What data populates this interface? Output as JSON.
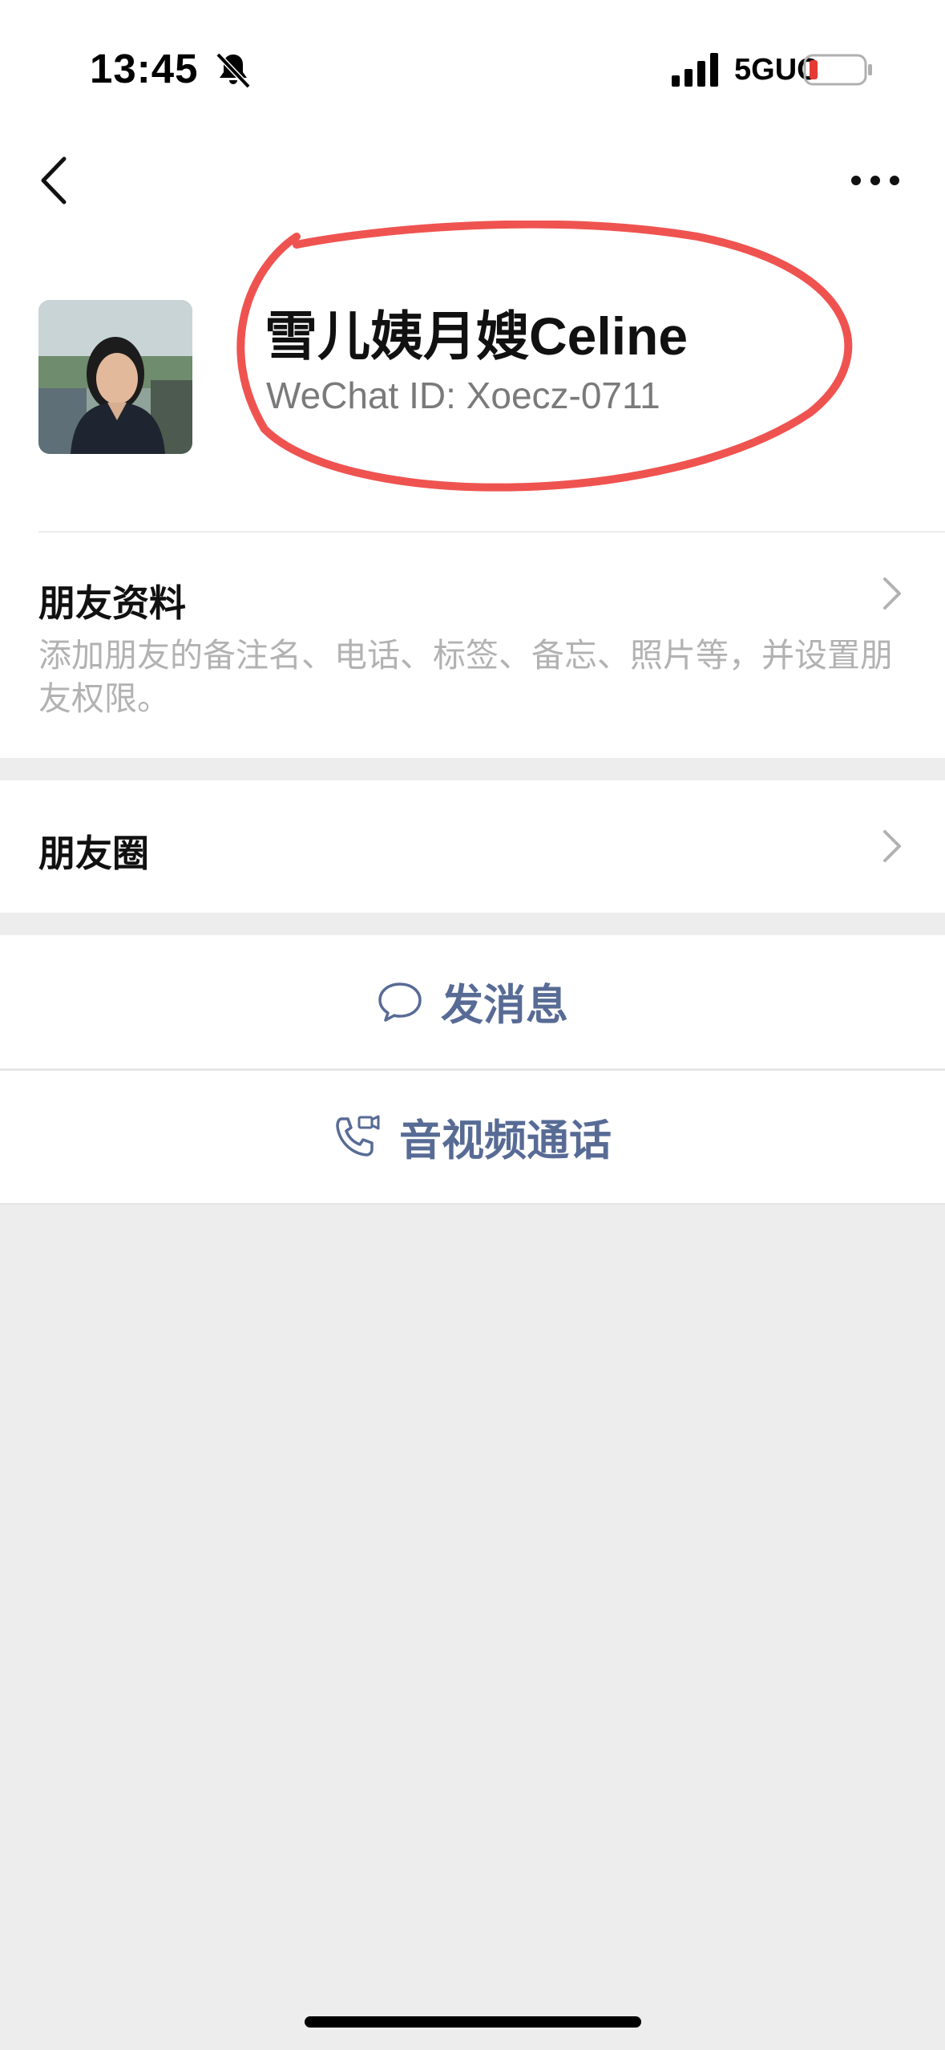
{
  "status_bar": {
    "time": "13:45",
    "network": "5GUC",
    "icons": [
      "bell-slash-icon",
      "signal-icon",
      "battery-low-icon"
    ],
    "battery_color": "#e53935"
  },
  "nav": {
    "back_icon": "chevron-left-icon",
    "more_icon": "ellipsis-icon"
  },
  "profile": {
    "display_name": "雪儿姨月嫂Celine",
    "wechat_id": "WeChat ID: Xoecz-0711",
    "annotation_color": "#ef5350"
  },
  "rows": {
    "friend_info": {
      "title": "朋友资料",
      "description": "添加朋友的备注名、电话、标签、备忘、照片等，并设置朋友权限。"
    },
    "moments": {
      "title": "朋友圈"
    }
  },
  "actions": {
    "message": {
      "label": "发消息",
      "icon": "chat-bubble-icon"
    },
    "call": {
      "label": "音视频通话",
      "icon": "phone-video-icon"
    }
  },
  "colors": {
    "link": "#576b95",
    "background": "#ededed"
  }
}
